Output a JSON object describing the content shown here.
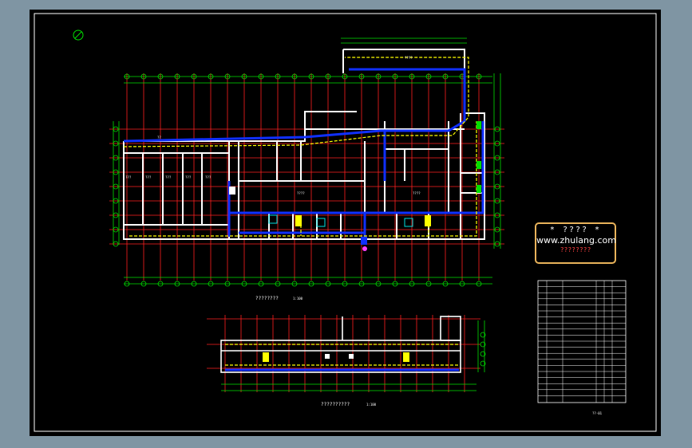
{
  "watermark": {
    "stars": "* ???? *",
    "url": "www.zhulang.com",
    "subtitle": "????????"
  },
  "plan_main": {
    "title": "????????",
    "scale": "1:100"
  },
  "plan_lower": {
    "title": "??????????",
    "scale": "1:100"
  },
  "room_labels": {
    "top_annex": "????",
    "corridor": "??",
    "bay": "???",
    "hall": "????"
  },
  "title_block": {
    "drawing_no": "??-01"
  },
  "colors": {
    "grid_axis": "#ff2020",
    "dimension": "#00e000",
    "wall": "#ffffff",
    "duct": "#1030ff",
    "pipe": "#ffff00",
    "cyan": "#00e0e0",
    "magenta": "#ff40ff",
    "watermark_border": "#e8b25a"
  }
}
